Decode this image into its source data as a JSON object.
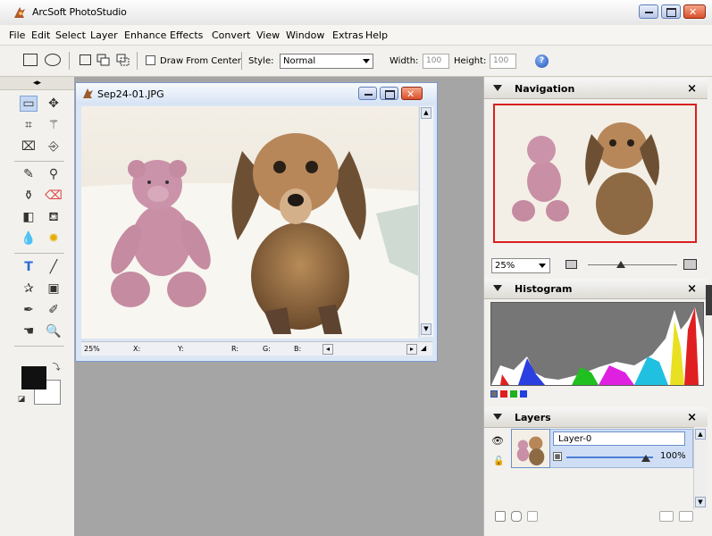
{
  "app": {
    "title": "ArcSoft PhotoStudio"
  },
  "menu": [
    "File",
    "Edit",
    "Select",
    "Layer",
    "Enhance",
    "Effects",
    "Convert",
    "View",
    "Window",
    "Extras",
    "Help"
  ],
  "options": {
    "draw_from_center_label": "Draw From Center",
    "style_label": "Style:",
    "style_value": "Normal",
    "width_label": "Width:",
    "width_value": "100",
    "height_label": "Height:",
    "height_value": "100",
    "help_glyph": "?"
  },
  "document": {
    "title": "Sep24-01.JPG",
    "status": {
      "zoom": "25%",
      "x_label": "X:",
      "y_label": "Y:",
      "r_label": "R:",
      "g_label": "G:",
      "b_label": "B:"
    }
  },
  "panels": {
    "navigation": {
      "title": "Navigation",
      "close": "×",
      "zoom_value": "25%"
    },
    "histogram": {
      "title": "Histogram",
      "close": "×",
      "channels": [
        "#6f6f6f",
        "#e02020",
        "#20b020",
        "#2040e0"
      ]
    },
    "layers": {
      "title": "Layers",
      "close": "×",
      "layer_name": "Layer-0",
      "opacity": "100%"
    }
  },
  "colors": {
    "foreground": "#111111",
    "background": "#ffffff",
    "nav_frame": "#d92020"
  },
  "icons": [
    "app-logo-icon",
    "rect-marquee-icon",
    "ellipse-marquee-icon",
    "new-selection-icon",
    "add-selection-icon",
    "subtract-selection-icon",
    "help-icon",
    "minimize-icon",
    "maximize-icon",
    "close-icon"
  ]
}
